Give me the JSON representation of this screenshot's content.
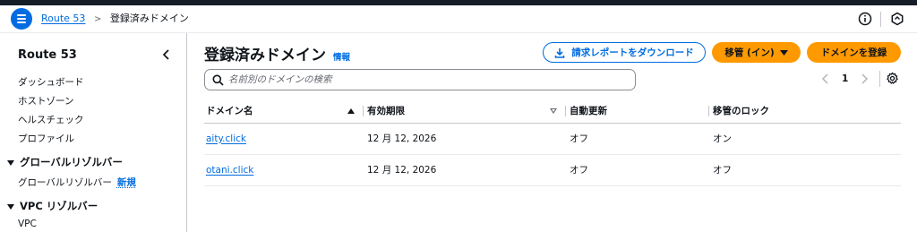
{
  "header": {
    "breadcrumb": {
      "service": "Route 53",
      "current": "登録済みドメイン"
    },
    "icons": {
      "menu": "hamburger-menu-icon",
      "info": "info-circle-icon",
      "notifications": "notification-icon"
    }
  },
  "sidebar": {
    "title": "Route 53",
    "items": [
      {
        "label": "ダッシュボード"
      },
      {
        "label": "ホストゾーン"
      },
      {
        "label": "ヘルスチェック"
      },
      {
        "label": "プロファイル"
      }
    ],
    "sections": [
      {
        "label": "グローバルリゾルバー",
        "items": [
          {
            "label": "グローバルリゾルバー",
            "badge": "新規"
          }
        ]
      },
      {
        "label": "VPC リゾルバー",
        "items": [
          {
            "label": "VPC"
          }
        ]
      }
    ]
  },
  "main": {
    "title": "登録済みドメイン",
    "info_link": "情報",
    "buttons": {
      "download": "請求レポートをダウンロード",
      "transfer": "移管 (イン)",
      "register": "ドメインを登録"
    },
    "search": {
      "placeholder": "名前別のドメインの検索",
      "value": ""
    },
    "pagination": {
      "current_page": "1"
    },
    "table": {
      "columns": [
        "ドメイン名",
        "有効期限",
        "自動更新",
        "移管のロック"
      ],
      "rows": [
        {
          "domain": "aity.click",
          "expiration": "12 月 12, 2026",
          "auto_renew": "オフ",
          "transfer_lock": "オン"
        },
        {
          "domain": "otani.click",
          "expiration": "12 月 12, 2026",
          "auto_renew": "オフ",
          "transfer_lock": "オフ"
        }
      ]
    }
  },
  "colors": {
    "link": "#006ce0",
    "primary_button": "#ff9900",
    "top_strip": "#161d26"
  }
}
